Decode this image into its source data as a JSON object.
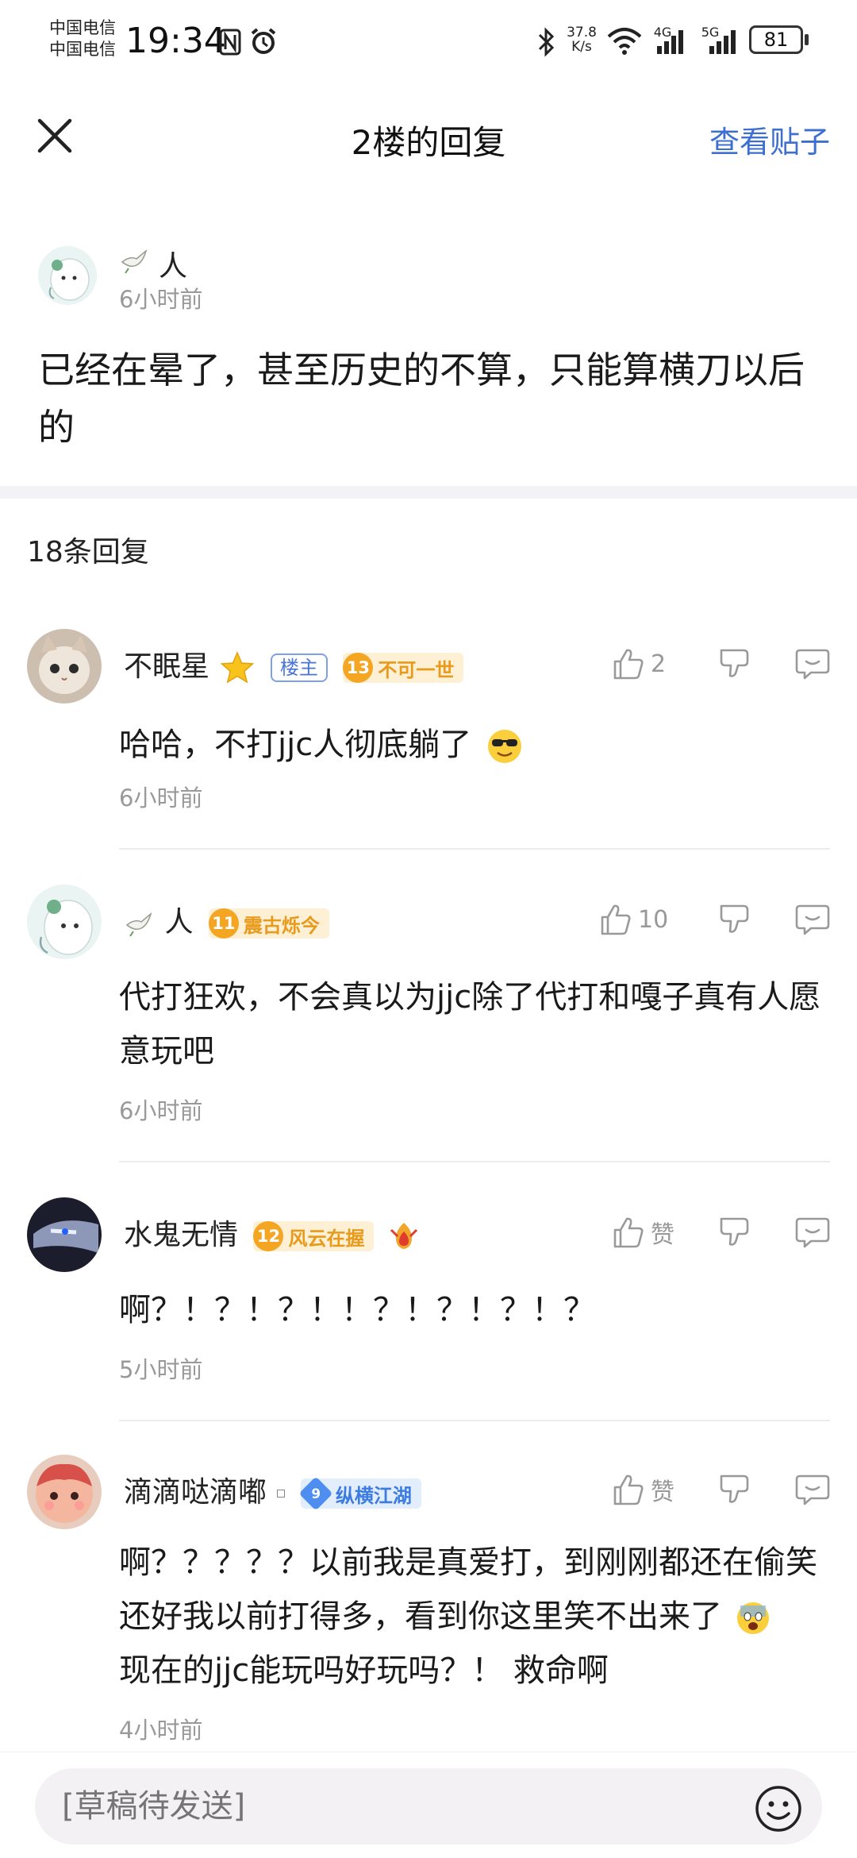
{
  "status_bar": {
    "carrier1": "中国电信",
    "carrier2": "中国电信",
    "time": "19:34",
    "net_speed_value": "37.8",
    "net_speed_unit": "K/s",
    "sig1_label": "4G",
    "sig2_label": "5G",
    "battery": "81"
  },
  "header": {
    "title": "2楼的回复",
    "view_post": "查看贴子"
  },
  "main_post": {
    "author": "人",
    "time": "6小时前",
    "text": "已经在晕了，甚至历史的不算，只能算横刀以后的"
  },
  "replies_count": "18条回复",
  "replies": [
    {
      "name": "不眠星",
      "host_badge": "楼主",
      "level": "13",
      "level_title": "不可一世",
      "level_color": "gold",
      "likes": "2",
      "text": "哈哈，不打jjc人彻底躺了",
      "time": "6小时前"
    },
    {
      "name": "人",
      "level": "11",
      "level_title": "震古烁今",
      "level_color": "gold",
      "likes": "10",
      "text": "代打狂欢，不会真以为jjc除了代打和嘎子真有人愿意玩吧",
      "time": "6小时前"
    },
    {
      "name": "水鬼无情",
      "level": "12",
      "level_title": "风云在握",
      "level_color": "gold",
      "likes": "赞",
      "text": "啊？！？！？！！？！？！？！？",
      "time": "5小时前"
    },
    {
      "name": "滴滴哒滴嘟",
      "level": "9",
      "level_title": "纵横江湖",
      "level_color": "blue",
      "likes": "赞",
      "text_part1": "啊？？？？？以前我是真爱打，到刚刚都还在偷笑还好我以前打得多，看到你这里笑不出来了",
      "text_part2": "现在的jjc能玩吗好玩吗？！ 救命啊",
      "time": "4小时前"
    }
  ],
  "input": {
    "placeholder": "[草稿待发送]"
  },
  "colors": {
    "accent": "#3d6fd1",
    "muted": "#999999",
    "gold_badge": "#f4a623",
    "blue_badge": "#4d8ef0"
  }
}
